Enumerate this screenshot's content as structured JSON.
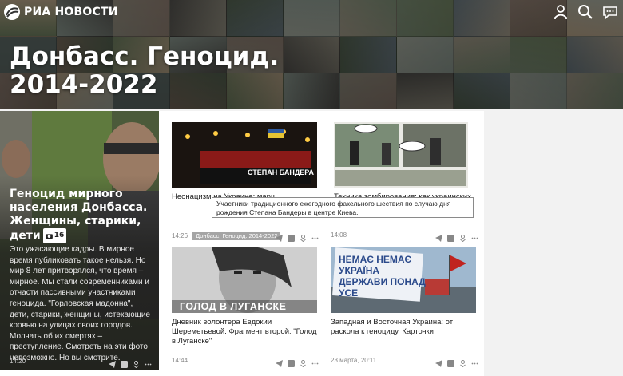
{
  "header": {
    "logo_text": "РИА НОВОСТИ",
    "title_line1": "Донбасс. Геноцид.",
    "title_line2": "2014-2022",
    "icons": [
      "user-icon",
      "search-icon",
      "chat-icon"
    ]
  },
  "feature": {
    "title": "Геноцид мирного населения Донбасса. Женщины, старики, дети",
    "gallery_count": "16",
    "lead": "Это ужасающие кадры. В мирное время публиковать такое нельзя. Но мир 8 лет притворялся, что время – мирное. Мы стали современниками и отчасти пассивными участниками геноцида. \"Горловская мадонна\", дети, старики, женщины, истекающие кровью на улицах своих городов. Молчать об их смертях – преступление. Смотреть на эти фото невозможно. Но вы смотрите.",
    "time": "14:20"
  },
  "cards": [
    {
      "title": "Неонацизм на Украине: марш",
      "time": "14:26",
      "tag": "Донбасс. Геноцид. 2014-2022",
      "image_caption": "СТЕПАН БАНДЕРА"
    },
    {
      "title": "Техника зомбирования: как украинских",
      "time": "14:08"
    },
    {
      "title": "Дневник волонтера Евдокии Шереметьевой. Фрагмент второй: \"Голод в Луганске\"",
      "time": "14:44",
      "image_caption": "ГОЛОД В ЛУГАНСКЕ"
    },
    {
      "title": "Западная и Восточная Украина: от раскола к геноциду. Карточки",
      "time": "23 марта, 20:11",
      "image_caption": "НЕМАЄ НЕМАЄ УКРАЇНА ДЕРЖАВИ ПОНАД УСЕ"
    }
  ],
  "tooltip": "Участники традиционного ежегодного факельного шествия по случаю дня рождения Степана Бандеры в центре Киева.",
  "colors": {
    "accent": "#333333",
    "tag_bg": "#a5a5a5",
    "meta": "#888888"
  }
}
